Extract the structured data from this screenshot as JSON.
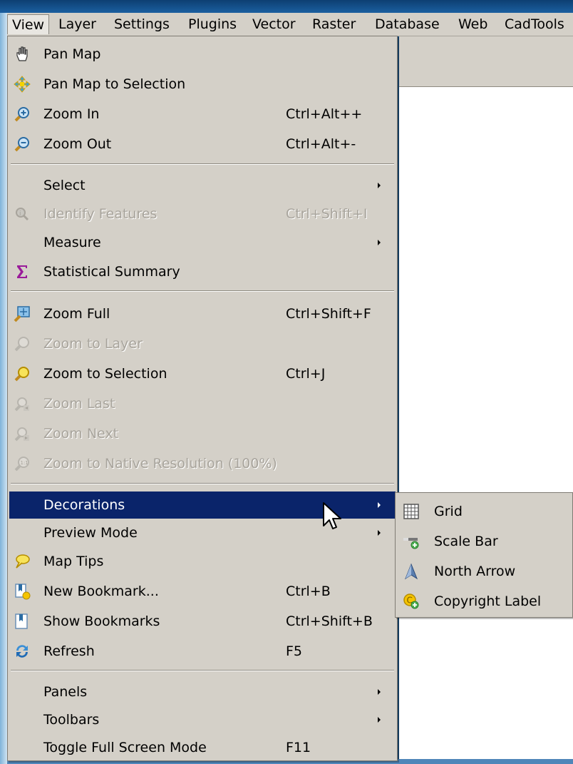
{
  "menubar": {
    "items": [
      "View",
      "Layer",
      "Settings",
      "Plugins",
      "Vector",
      "Raster",
      "Database",
      "Web",
      "CadTools"
    ]
  },
  "view_menu": {
    "items": [
      {
        "label": "Pan Map",
        "shortcut": "",
        "icon": "pan-hand-icon"
      },
      {
        "label": "Pan Map to Selection",
        "shortcut": "",
        "icon": "pan-selection-icon"
      },
      {
        "label": "Zoom In",
        "shortcut": "Ctrl+Alt++",
        "icon": "zoom-in-icon"
      },
      {
        "label": "Zoom Out",
        "shortcut": "Ctrl+Alt+-",
        "icon": "zoom-out-icon"
      },
      {
        "label": "Select",
        "shortcut": "",
        "submenu": true
      },
      {
        "label": "Identify Features",
        "shortcut": "Ctrl+Shift+I",
        "icon": "identify-icon",
        "disabled": true
      },
      {
        "label": "Measure",
        "shortcut": "",
        "submenu": true
      },
      {
        "label": "Statistical Summary",
        "shortcut": "",
        "icon": "sigma-icon"
      },
      {
        "label": "Zoom Full",
        "shortcut": "Ctrl+Shift+F",
        "icon": "zoom-full-icon"
      },
      {
        "label": "Zoom to Layer",
        "shortcut": "",
        "icon": "zoom-layer-icon",
        "disabled": true
      },
      {
        "label": "Zoom to Selection",
        "shortcut": "Ctrl+J",
        "icon": "zoom-selection-icon"
      },
      {
        "label": "Zoom Last",
        "shortcut": "",
        "icon": "zoom-last-icon",
        "disabled": true
      },
      {
        "label": "Zoom Next",
        "shortcut": "",
        "icon": "zoom-next-icon",
        "disabled": true
      },
      {
        "label": "Zoom to Native Resolution (100%)",
        "shortcut": "",
        "icon": "zoom-native-icon",
        "disabled": true
      },
      {
        "label": "Decorations",
        "shortcut": "",
        "submenu": true,
        "highlighted": true
      },
      {
        "label": "Preview Mode",
        "shortcut": "",
        "submenu": true
      },
      {
        "label": "Map Tips",
        "shortcut": "",
        "icon": "map-tips-icon"
      },
      {
        "label": "New Bookmark...",
        "shortcut": "Ctrl+B",
        "icon": "new-bookmark-icon"
      },
      {
        "label": "Show Bookmarks",
        "shortcut": "Ctrl+Shift+B",
        "icon": "show-bookmarks-icon"
      },
      {
        "label": "Refresh",
        "shortcut": "F5",
        "icon": "refresh-icon"
      },
      {
        "label": "Panels",
        "shortcut": "",
        "submenu": true
      },
      {
        "label": "Toolbars",
        "shortcut": "",
        "submenu": true
      },
      {
        "label": "Toggle Full Screen Mode",
        "shortcut": "F11"
      }
    ]
  },
  "decorations_submenu": {
    "items": [
      {
        "label": "Grid",
        "icon": "grid-icon"
      },
      {
        "label": "Scale Bar",
        "icon": "scale-bar-icon"
      },
      {
        "label": "North Arrow",
        "icon": "north-arrow-icon"
      },
      {
        "label": "Copyright Label",
        "icon": "copyright-label-icon"
      }
    ]
  },
  "colors": {
    "menu_background": "#d4d0c8",
    "highlight": "#0a246a",
    "disabled_text": "#a8a49c"
  }
}
